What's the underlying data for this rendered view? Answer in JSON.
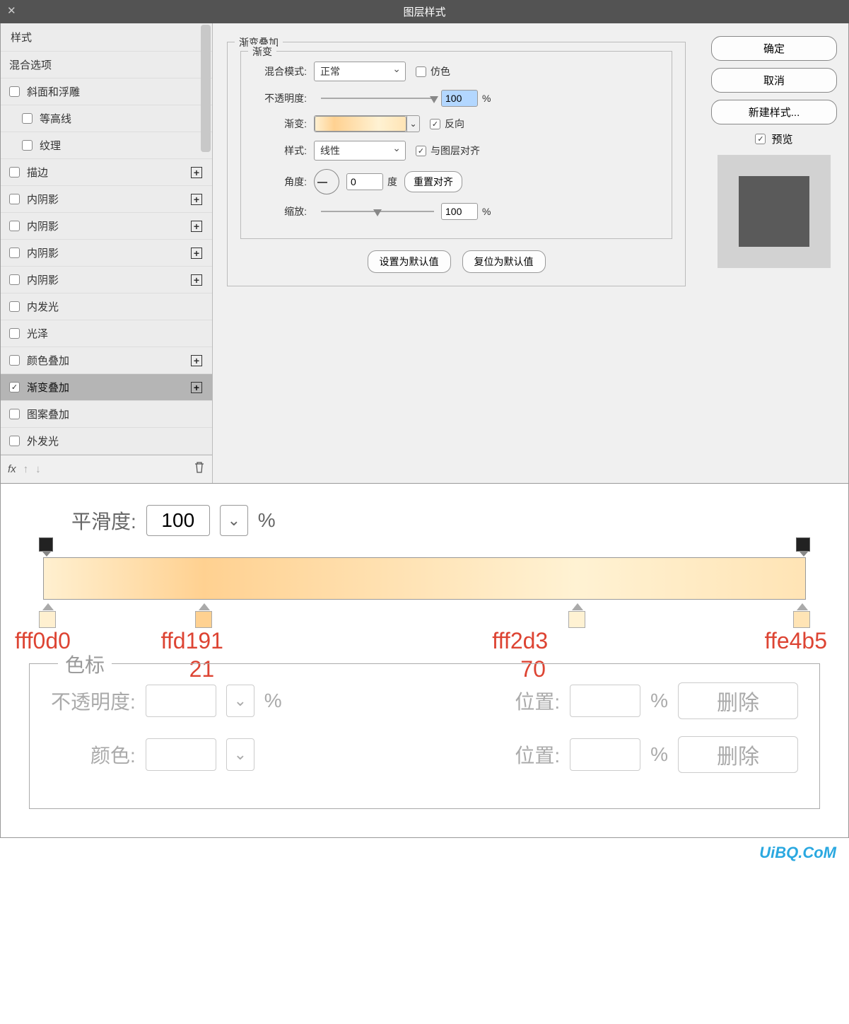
{
  "titlebar": {
    "title": "图层样式"
  },
  "leftPanel": {
    "header": "样式",
    "items": [
      {
        "label": "混合选项",
        "checkbox": false,
        "plus": false
      },
      {
        "label": "斜面和浮雕",
        "checkbox": true,
        "plus": false
      },
      {
        "label": "等高线",
        "checkbox": true,
        "indent": true,
        "plus": false
      },
      {
        "label": "纹理",
        "checkbox": true,
        "indent": true,
        "plus": false
      },
      {
        "label": "描边",
        "checkbox": true,
        "plus": true
      },
      {
        "label": "内阴影",
        "checkbox": true,
        "plus": true
      },
      {
        "label": "内阴影",
        "checkbox": true,
        "plus": true
      },
      {
        "label": "内阴影",
        "checkbox": true,
        "plus": true
      },
      {
        "label": "内阴影",
        "checkbox": true,
        "plus": true
      },
      {
        "label": "内发光",
        "checkbox": true,
        "plus": false
      },
      {
        "label": "光泽",
        "checkbox": true,
        "plus": false
      },
      {
        "label": "颜色叠加",
        "checkbox": true,
        "plus": true
      },
      {
        "label": "渐变叠加",
        "checkbox": true,
        "checked": true,
        "plus": true,
        "selected": true
      },
      {
        "label": "图案叠加",
        "checkbox": true,
        "plus": false
      },
      {
        "label": "外发光",
        "checkbox": true,
        "plus": false
      }
    ],
    "footer": {
      "fx": "fx"
    }
  },
  "center": {
    "sectionTitle": "渐变叠加",
    "innerTitle": "渐变",
    "blendMode": {
      "label": "混合模式:",
      "value": "正常",
      "dither": "仿色"
    },
    "opacity": {
      "label": "不透明度:",
      "value": "100",
      "unit": "%"
    },
    "gradient": {
      "label": "渐变:",
      "reverse": "反向"
    },
    "style": {
      "label": "样式:",
      "value": "线性",
      "align": "与图层对齐"
    },
    "angle": {
      "label": "角度:",
      "value": "0",
      "unit": "度",
      "reset": "重置对齐"
    },
    "scale": {
      "label": "缩放:",
      "value": "100",
      "unit": "%"
    },
    "btnDefault": "设置为默认值",
    "btnReset": "复位为默认值"
  },
  "right": {
    "ok": "确定",
    "cancel": "取消",
    "newStyle": "新建样式...",
    "preview": "预览"
  },
  "gradEditor": {
    "smoothness": {
      "label": "平滑度:",
      "value": "100",
      "unit": "%"
    },
    "stops": [
      {
        "pos": 0,
        "color": "fff0d0",
        "sub": ""
      },
      {
        "pos": 21,
        "color": "ffd191",
        "sub": "21"
      },
      {
        "pos": 70,
        "color": "fff2d3",
        "sub": "70"
      },
      {
        "pos": 100,
        "color": "ffe4b5",
        "sub": ""
      }
    ],
    "stopPanel": {
      "legend": "色标",
      "opacityLabel": "不透明度:",
      "posLabel": "位置:",
      "colorLabel": "颜色:",
      "pct": "%",
      "delete": "删除"
    }
  },
  "watermark": "UiBQ.CoM"
}
